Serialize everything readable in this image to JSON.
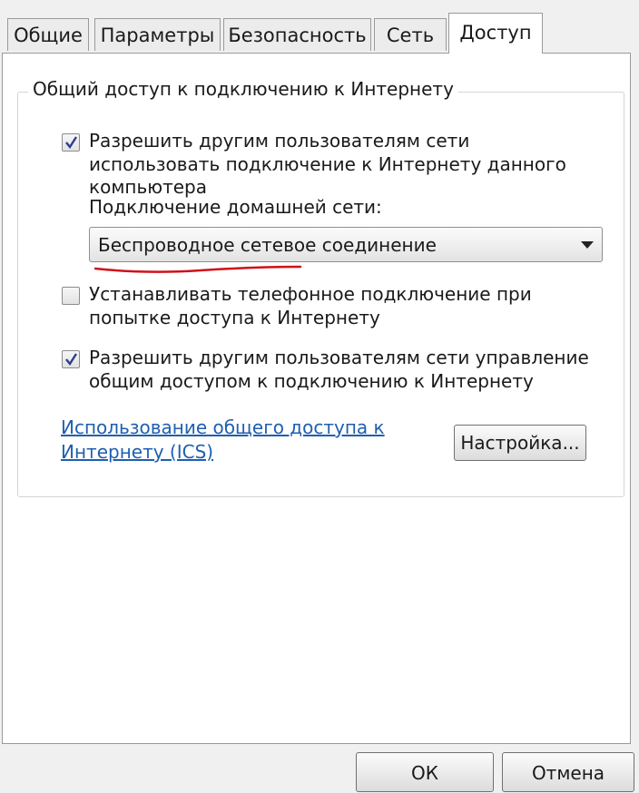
{
  "tabs": {
    "general": "Общие",
    "parameters": "Параметры",
    "security": "Безопасность",
    "network": "Сеть",
    "sharing": "Доступ"
  },
  "group": {
    "title": "Общий доступ к подключению к Интернету"
  },
  "allow_sharing": {
    "checked": true,
    "line1": "Разрешить другим пользователям сети",
    "line2": "использовать подключение к Интернету данного",
    "line3": "компьютера"
  },
  "home_network": {
    "label": "Подключение домашней сети:",
    "selected": "Беспроводное сетевое соединение"
  },
  "dial_on_demand": {
    "checked": false,
    "line1": "Устанавливать телефонное подключение при",
    "line2": "попытке доступа к Интернету"
  },
  "allow_control": {
    "checked": true,
    "line1": "Разрешить другим пользователям сети управление",
    "line2": "общим доступом к подключению к Интернету"
  },
  "help_link": {
    "line1": "Использование общего доступа к",
    "line2": "Интернету (ICS)"
  },
  "settings_button": "Настройка...",
  "footer": {
    "ok": "ОК",
    "cancel": "Отмена"
  },
  "colors": {
    "link": "#1f5fb0",
    "annotation_underline": "#d0101a"
  }
}
